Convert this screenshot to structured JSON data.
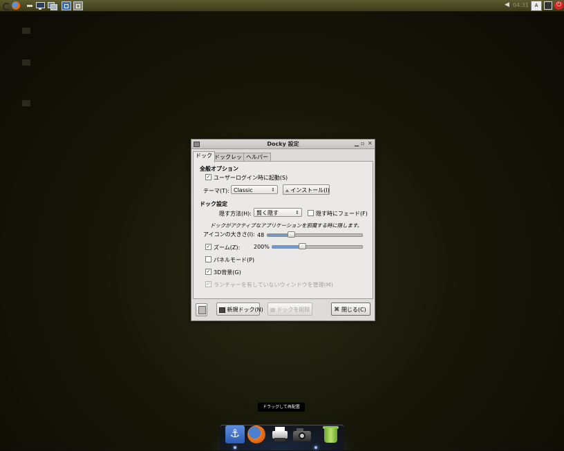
{
  "top_panel": {
    "ime_label": "A",
    "time": "04:31",
    "right_arrow": "◀"
  },
  "dialog": {
    "title": "Docky 設定",
    "tabs": [
      "ドック",
      "ドックレット",
      "ヘルパー"
    ],
    "general": {
      "heading": "全般オプション",
      "autostart_label": "ユーザーログイン時に起動(S)",
      "autostart_checked": true,
      "theme_label": "テーマ(T):",
      "theme_value": "Classic",
      "install_button": "インストール(I)"
    },
    "dock_settings": {
      "heading": "ドック設定",
      "hide_label": "隠す方法(H):",
      "hide_value": "賢く隠す",
      "fade_label": "隠す時にフェード(F)",
      "fade_checked": false,
      "hide_description": "ドックがアクティブなアプリケーションを邪魔する時に隠します。",
      "icon_size_label": "アイコンの大きさ(I):",
      "icon_size_value": "48",
      "icon_size_level": 0.25,
      "zoom_label": "ズーム(Z):",
      "zoom_checked": true,
      "zoom_value": "200%",
      "zoom_level": 0.33,
      "panel_mode_label": "パネルモード(P)",
      "panel_mode_checked": false,
      "bg3d_label": "3D背景(G)",
      "bg3d_checked": true,
      "manage_windows_label": "ランチャーを有していないウィンドウを管理(M)",
      "manage_windows_checked": true
    },
    "buttons": {
      "new_dock": "新規ドック(N)",
      "delete_dock": "ドックを削除",
      "close": "閉じる(C)"
    }
  },
  "dock": {
    "tooltip": "ドラッグして再配置",
    "icons": [
      "anchor-icon",
      "firefox-icon",
      "printer-icon",
      "camera-icon",
      "trash-icon"
    ]
  }
}
